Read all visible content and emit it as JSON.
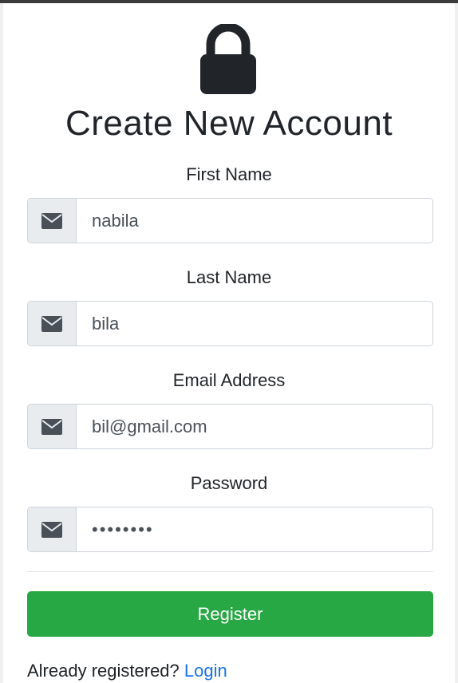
{
  "form": {
    "title": "Create New Account",
    "fields": [
      {
        "label": "First Name",
        "value": "nabila",
        "icon": "envelope-icon"
      },
      {
        "label": "Last Name",
        "value": "bila",
        "icon": "envelope-icon"
      },
      {
        "label": "Email Address",
        "value": "bil@gmail.com",
        "icon": "envelope-icon"
      },
      {
        "label": "Password",
        "value": "••••••••",
        "icon": "envelope-icon"
      }
    ],
    "register_label": "Register",
    "footer_text": "Already registered?",
    "login_link": "Login"
  },
  "colors": {
    "primary_button": "#28a745",
    "link": "#1a73e8",
    "addon_bg": "#e9ecef"
  }
}
